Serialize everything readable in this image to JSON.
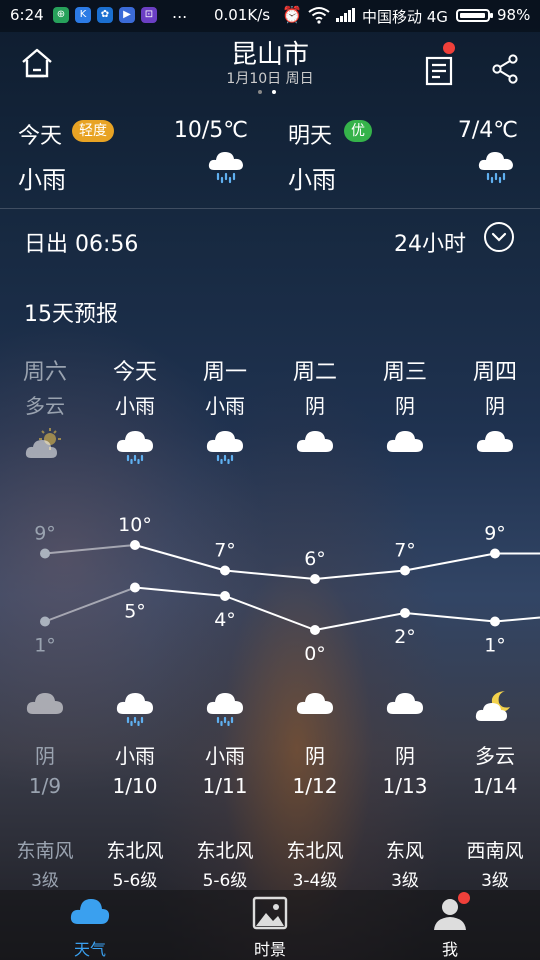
{
  "status_bar": {
    "time": "6:24",
    "app_icons": [
      {
        "name": "app-icon-green",
        "color": "#27a15b",
        "glyph": "⊕"
      },
      {
        "name": "app-icon-blue",
        "color": "#2c7be5",
        "glyph": "K"
      },
      {
        "name": "app-icon-blue-2",
        "color": "#1b6fd0",
        "glyph": "✿"
      },
      {
        "name": "app-icon-blue-3",
        "color": "#3b6bd8",
        "glyph": "▶"
      },
      {
        "name": "app-icon-purple",
        "color": "#6b3fc4",
        "glyph": "⊡"
      }
    ],
    "dots": "...",
    "net_speed": "0.01K/s",
    "carrier": "中国移动 4G",
    "battery": "98%",
    "battery_level": 0.98
  },
  "header": {
    "city": "昆山市",
    "date": "1月10日 周日",
    "page_count": 2,
    "active_page": 1
  },
  "today": {
    "label": "今天",
    "aqi": "轻度",
    "aqi_color": "#e8a324",
    "temp_range": "10/5℃",
    "condition": "小雨",
    "icon": "rain-cloud-icon"
  },
  "tomorrow": {
    "label": "明天",
    "aqi": "优",
    "aqi_color": "#35b34a",
    "temp_range": "7/4℃",
    "condition": "小雨",
    "icon": "rain-cloud-icon"
  },
  "sunrise": "日出 06:56",
  "hours24_label": "24小时",
  "forecast_title": "15天预报",
  "days": [
    {
      "weekday": "周六",
      "day_cond": "多云",
      "day_icon": "partly-cloudy",
      "high": 9,
      "high_label": "9°",
      "low": 1,
      "low_label": "1°",
      "night_icon": "cloud",
      "night_cond": "阴",
      "date": "1/9",
      "wind_dir": "东南风",
      "wind_level": "3级",
      "past": true
    },
    {
      "weekday": "今天",
      "day_cond": "小雨",
      "day_icon": "rain",
      "high": 10,
      "high_label": "10°",
      "low": 5,
      "low_label": "5°",
      "night_icon": "rain",
      "night_cond": "小雨",
      "date": "1/10",
      "wind_dir": "东北风",
      "wind_level": "5-6级",
      "past": false
    },
    {
      "weekday": "周一",
      "day_cond": "小雨",
      "day_icon": "rain",
      "high": 7,
      "high_label": "7°",
      "low": 4,
      "low_label": "4°",
      "night_icon": "rain",
      "night_cond": "小雨",
      "date": "1/11",
      "wind_dir": "东北风",
      "wind_level": "5-6级",
      "past": false
    },
    {
      "weekday": "周二",
      "day_cond": "阴",
      "day_icon": "cloud",
      "high": 6,
      "high_label": "6°",
      "low": 0,
      "low_label": "0°",
      "night_icon": "cloud",
      "night_cond": "阴",
      "date": "1/12",
      "wind_dir": "东北风",
      "wind_level": "3-4级",
      "past": false
    },
    {
      "weekday": "周三",
      "day_cond": "阴",
      "day_icon": "cloud",
      "high": 7,
      "high_label": "7°",
      "low": 2,
      "low_label": "2°",
      "night_icon": "cloud",
      "night_cond": "阴",
      "date": "1/13",
      "wind_dir": "东风",
      "wind_level": "3级",
      "past": false
    },
    {
      "weekday": "周四",
      "day_cond": "阴",
      "day_icon": "cloud",
      "high": 9,
      "high_label": "9°",
      "low": 1,
      "low_label": "1°",
      "night_icon": "moon-cloud",
      "night_cond": "多云",
      "date": "1/14",
      "wind_dir": "西南风",
      "wind_level": "3级",
      "past": false
    }
  ],
  "tabs": [
    {
      "label": "天气",
      "icon": "cloud-tab-icon",
      "active": true,
      "color": "#3aa0ef"
    },
    {
      "label": "时景",
      "icon": "picture-tab-icon",
      "active": false,
      "color": "#dddddd"
    },
    {
      "label": "我",
      "icon": "person-tab-icon",
      "active": false,
      "color": "#dddddd",
      "badge": true
    }
  ]
}
